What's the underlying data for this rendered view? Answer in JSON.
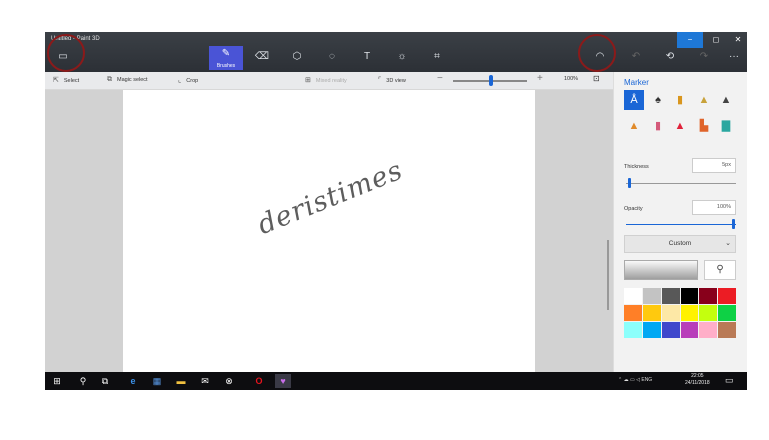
{
  "window": {
    "title": "Untitled - Paint 3D",
    "controls": {
      "minimize": "−",
      "maximize": "◻",
      "close": "✕"
    }
  },
  "toolbar": {
    "menu_icon": "menu-icon",
    "brushes_label": "Brushes",
    "tools": [
      "brushes-icon",
      "2d-shapes-icon",
      "3d-shapes-icon",
      "stickers-icon",
      "text-icon",
      "effects-icon",
      "canvas-icon"
    ],
    "text_glyph": "T",
    "mixed_reality_icon": "mixed-reality-icon",
    "history_icon": "history-icon",
    "undo_icon": "undo-icon",
    "redo_icon": "redo-icon",
    "more_glyph": "···"
  },
  "subtoolbar": {
    "select": "Select",
    "magic_select": "Magic select",
    "crop": "Crop",
    "mixed_reality": "Mixed reality",
    "view_3d": "3D view",
    "zoom_minus": "−",
    "zoom_plus": "+",
    "zoom_level": "100%",
    "zoom_level_value": 100
  },
  "canvas": {
    "handwriting": "deristimes"
  },
  "panel": {
    "title": "Marker",
    "thickness_label": "Thickness",
    "thickness_value": "5px",
    "opacity_label": "Opacity",
    "opacity_value": "100%",
    "opacity_level": 1.0,
    "custom_label": "Custom",
    "tools_row1": [
      "calligraphy-pen-icon",
      "oil-brush-icon",
      "watercolor-icon",
      "pixel-pen-icon",
      "pencil-icon"
    ],
    "tools_row2": [
      "eraser-icon",
      "crayon-icon",
      "marker-icon",
      "spray-can-icon",
      "fill-icon"
    ],
    "palette": [
      "#ffffff",
      "#c3c3c3",
      "#585858",
      "#000000",
      "#88001b",
      "#ec1c24",
      "#ff7f27",
      "#ffc90e",
      "#fde8a6",
      "#fff200",
      "#c4ff0e",
      "#0ed145",
      "#8cfffb",
      "#00a8f3",
      "#3f48cc",
      "#b83dba",
      "#ffaec8",
      "#b97a56"
    ],
    "palette_custom": [
      "#c3c3c3",
      "#ff0000",
      "#00ff00",
      "#2020c0",
      "#34a853",
      "#ff4500"
    ]
  },
  "taskbar": {
    "tray_lang": "ENG",
    "time": "22:05",
    "date": "24/11/2018"
  },
  "colors": {
    "accent": "#1a66d6",
    "selected_tool": "#4a54d6",
    "annotation_circle": "#8b1a1a"
  }
}
